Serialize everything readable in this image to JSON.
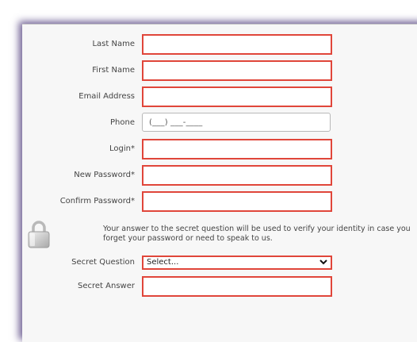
{
  "form": {
    "last_name": {
      "label": "Last Name",
      "value": ""
    },
    "first_name": {
      "label": "First Name",
      "value": ""
    },
    "email": {
      "label": "Email Address",
      "value": ""
    },
    "phone": {
      "label": "Phone",
      "mask": "(___) ___-____"
    },
    "login": {
      "label": "Login*",
      "value": ""
    },
    "new_password": {
      "label": "New Password*",
      "value": ""
    },
    "confirm_password": {
      "label": "Confirm Password*",
      "value": ""
    },
    "security_notice": "Your answer to the secret question will be used to verify your identity in case you forget your password or need to speak to us.",
    "secret_question": {
      "label": "Secret Question",
      "selected": "Select..."
    },
    "secret_answer": {
      "label": "Secret Answer",
      "value": ""
    }
  },
  "icons": {
    "lock": "lock-icon",
    "dropdown": "chevron-down-icon"
  },
  "colors": {
    "error_border": "#e0463a",
    "panel_bg": "#f7f7f7",
    "shadow": "#3c286e"
  }
}
